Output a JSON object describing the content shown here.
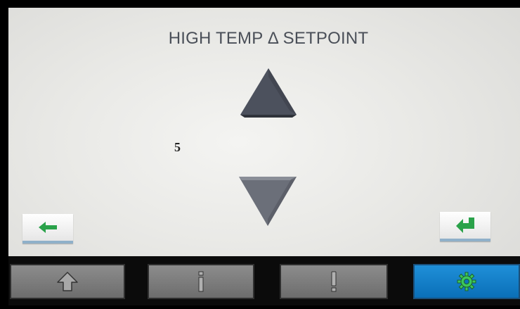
{
  "screen": {
    "title": "HIGH TEMP Δ SETPOINT",
    "value": "5"
  },
  "controls": {
    "increase_icon": "arrow-up-triangle",
    "decrease_icon": "arrow-down-triangle",
    "back_icon": "green-left-arrow",
    "enter_icon": "green-enter-arrow"
  },
  "tabs": [
    {
      "id": "home",
      "icon": "home-icon",
      "active": false
    },
    {
      "id": "info",
      "icon": "info-icon",
      "active": false
    },
    {
      "id": "alarm",
      "icon": "exclamation-icon",
      "active": false
    },
    {
      "id": "settings",
      "icon": "gear-icon",
      "active": true
    }
  ],
  "colors": {
    "accent_active_tab": "#1480c8",
    "arrow_green": "#2aa24a",
    "triangle_fill": "#5b5f6a"
  }
}
